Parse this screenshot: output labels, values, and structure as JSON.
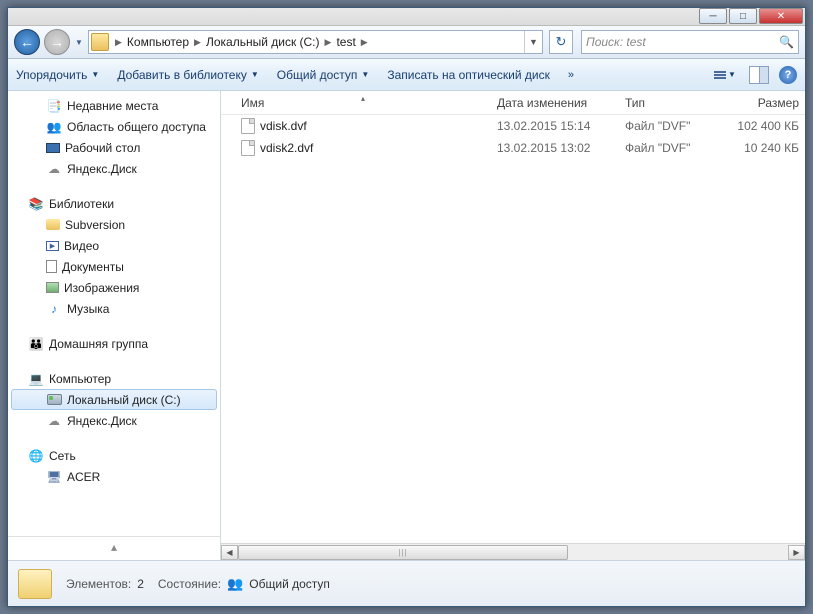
{
  "breadcrumbs": [
    "Компьютер",
    "Локальный диск (C:)",
    "test"
  ],
  "search": {
    "placeholder": "Поиск: test"
  },
  "toolbar": {
    "organize": "Упорядочить",
    "addlib": "Добавить в библиотеку",
    "share": "Общий доступ",
    "burn": "Записать на оптический диск"
  },
  "tree": {
    "recent": "Недавние места",
    "publicshare": "Область общего доступа",
    "desktop": "Рабочий стол",
    "yadisk": "Яндекс.Диск",
    "libs": "Библиотеки",
    "svn": "Subversion",
    "video": "Видео",
    "docs": "Документы",
    "pics": "Изображения",
    "music": "Музыка",
    "homegroup": "Домашняя группа",
    "computer": "Компьютер",
    "localc": "Локальный диск (C:)",
    "yadisk2": "Яндекс.Диск",
    "network": "Сеть",
    "acer": "ACER"
  },
  "columns": {
    "name": "Имя",
    "date": "Дата изменения",
    "type": "Тип",
    "size": "Размер"
  },
  "files": [
    {
      "name": "vdisk.dvf",
      "date": "13.02.2015 15:14",
      "type": "Файл \"DVF\"",
      "size": "102 400 КБ"
    },
    {
      "name": "vdisk2.dvf",
      "date": "13.02.2015 13:02",
      "type": "Файл \"DVF\"",
      "size": "10 240 КБ"
    }
  ],
  "status": {
    "elements_label": "Элементов:",
    "elements_count": "2",
    "state_label": "Состояние:",
    "state_value": "Общий доступ"
  }
}
